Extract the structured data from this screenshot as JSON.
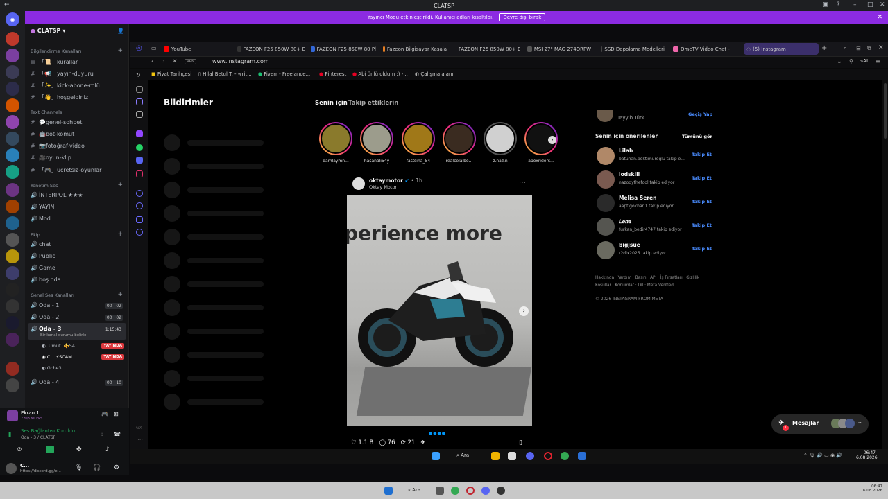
{
  "window": {
    "title": "CLATSP"
  },
  "streamer_banner": {
    "text": "Yayıncı Modu etkinleştirildi. Kullanıcı adları kısaltıldı.",
    "button": "Devre dışı bırak"
  },
  "server": {
    "name": "CLATSP"
  },
  "channels": {
    "cat1": "Bilgilendirme Kanalları",
    "c1": "「📜」kurallar",
    "c2": "「📢」yayın-duyuru",
    "c3": "「✨」kick-abone-rolü",
    "c4": "「👋」hoşgeldiniz",
    "cat2": "Text Channels",
    "c5": "💬genel-sohbet",
    "c6": "🤖bot-komut",
    "c7": "📷fotoğraf-video",
    "c8": "🎥oyun-klip",
    "c9": "「🎮」ücretsiz-oyunlar",
    "cat3": "Yönetim Ses",
    "v1": "İNTERPOL ★★★",
    "v2": "YAYIN",
    "v3": "Mod",
    "cat4": "Ekip",
    "v4": "chat",
    "v5": "Public",
    "v6": "Game",
    "v7": "boş oda",
    "cat5": "Genel Ses Kanalları",
    "o1": "Oda - 1",
    "o1t": "00 : 02",
    "o2": "Oda - 2",
    "o2t": "00 : 02",
    "o3": "Oda - 3",
    "o3t": "1:15:43",
    "o3status": "Bir kanal durumu belirle",
    "u1": ".Umut. ⚜️54",
    "u2": "C... ⚡SCAM",
    "u3": "Gcbe3",
    "live": "YAYINDA",
    "o4": "Oda - 4",
    "o4t": "00 : 10"
  },
  "user_panel": {
    "stream_title": "Ekran 1",
    "stream_sub": "720p 60 FPS",
    "voice_status": "Ses Bağlantısı Kuruldu",
    "voice_channel": "Oda - 3 / CLATSP",
    "user": "C...",
    "user_sub": "https://discord.gg/e..."
  },
  "browser": {
    "url": "www.instagram.com",
    "vpn": "VPN",
    "tabs": [
      "YouTube",
      "FAZEON F25 850W 80+ E",
      "FAZEON F25 850W 80 Pl",
      "Fazeon Bilgisayar Kasala",
      "FAZEON F25 850W 80+ E",
      "MSI 27\" MAG 274QRFW",
      "SSD Depolama Modelleri",
      "OmeTV Video Chat -",
      "(5) Instagram"
    ],
    "bookmarks": [
      "Fiyat Tarihçesi",
      "Hilal Betul T. - writ...",
      "Fiverr - Freelance...",
      "Pinterest",
      "Abi ünlü oldum :) -...",
      "Çalışma alanı"
    ]
  },
  "instagram": {
    "notifications_title": "Bildirimler",
    "tab_for_you": "Senin için",
    "tab_following": "Takip ettiklerin",
    "stories": [
      "damlaymn...",
      "hasanali54y",
      "fastsina_54",
      "realcelalbe...",
      "z.naz.n",
      "apexriders..."
    ],
    "post": {
      "user": "oktaymotor",
      "time": "1h",
      "subtitle": "Oktay Motor",
      "image_text": "perience more",
      "likes": "1.1 B",
      "comments": "76",
      "shares": "21"
    },
    "current_user_sub": "Tayyib Türk",
    "switch": "Geçiş Yap",
    "suggested_title": "Senin için önerilenler",
    "see_all": "Tümünü gör",
    "follow": "Takip Et",
    "suggestions": [
      {
        "name": "Lilah",
        "sub": "batuhan.bektimuroglu takip e..."
      },
      {
        "name": "lodskiii",
        "sub": "nazodythefool takip ediyor"
      },
      {
        "name": "Melisa Seren",
        "sub": "aaptigokhan1 takip ediyor"
      },
      {
        "name": "𝑳𝒆𝒏𝒂",
        "sub": "furkan_bedir4747 takip ediyor"
      },
      {
        "name": "bigjsue",
        "sub": "r2dix2025 takip ediyor"
      }
    ],
    "footer_links": "Hakkında · Yardım · Basın · API · İş Fırsatları · Gizlilik · Koşullar · Konumlar · Dil · Meta Verified",
    "copyright": "© 2026 INSTAGRAM FROM META",
    "messages": "Mesajlar",
    "messages_badge": "1"
  },
  "taskbar": {
    "search": "Ara",
    "time": "06:47",
    "date": "6.08.2026",
    "search2": "Ara",
    "time2": "06:47",
    "date2": "6.08.2026"
  }
}
